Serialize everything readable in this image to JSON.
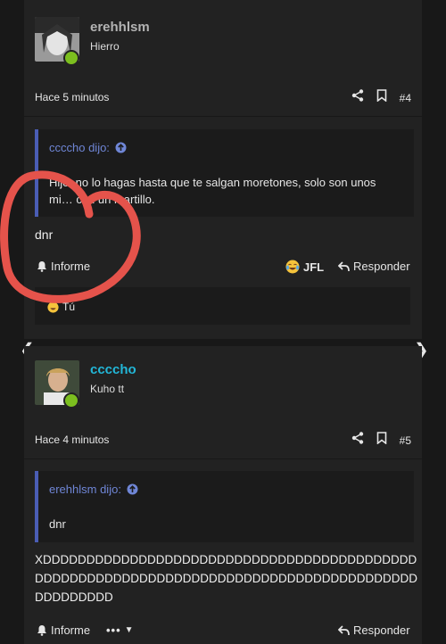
{
  "posts": [
    {
      "username": "erehhlsm",
      "user_title": "Hierro",
      "time": "Hace 5 minutos",
      "post_number": "#4",
      "quote": {
        "author": "ccccho dijo:",
        "lines": [
          "Hijo, no lo hagas hasta que te salgan moretones, solo son unos",
          "mi… con un martillo."
        ]
      },
      "message": "dnr",
      "actions": {
        "report": "Informe",
        "reaction": "JFL",
        "reply": "Responder"
      },
      "reaction_peek": "Tú",
      "colors": {
        "username": "#b3b3b3"
      }
    },
    {
      "username": "ccccho",
      "user_title": "Kuho tt",
      "time": "Hace 4 minutos",
      "post_number": "#5",
      "quote": {
        "author": "erehhlsm dijo:",
        "lines": [
          "dnr"
        ]
      },
      "message_lines": [
        "XDDDDDDDDDDDDDDDDDDDDDDDDDDDDDDDDDDDDDDDDDDD",
        "DDDDDDDDDDDDDDDDDDDDDDDDDDDDDDDDDDDDDDDDDDDD",
        "DDDDDDDDD"
      ],
      "actions": {
        "report": "Informe",
        "reply": "Responder"
      },
      "colors": {
        "username": "#22b7d8"
      }
    }
  ],
  "colors": {
    "accent_quote": "#4a5db5",
    "online": "#7cbf1f",
    "annotation": "#e5534b"
  }
}
